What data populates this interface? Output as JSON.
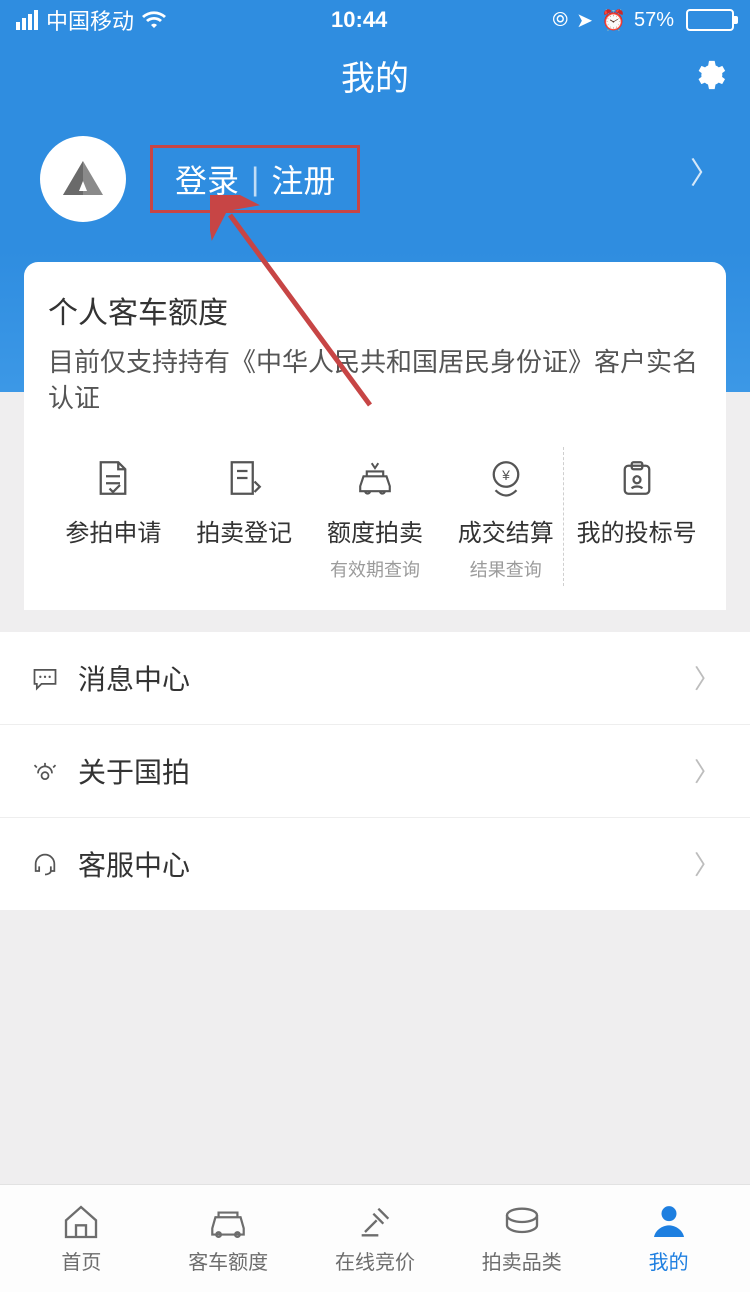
{
  "statusbar": {
    "carrier": "中国移动",
    "time": "10:44",
    "battery_pct": "57%"
  },
  "header": {
    "title": "我的",
    "login_label": "登录",
    "register_label": "注册"
  },
  "card": {
    "title": "个人客车额度",
    "desc": "目前仅支持持有《中华人民共和国居民身份证》客户实名认证",
    "actions": [
      {
        "label": "参拍申请",
        "sub": ""
      },
      {
        "label": "拍卖登记",
        "sub": ""
      },
      {
        "label": "额度拍卖",
        "sub": "有效期查询"
      },
      {
        "label": "成交结算",
        "sub": "结果查询"
      },
      {
        "label": "我的投标号",
        "sub": ""
      }
    ]
  },
  "list": [
    {
      "label": "消息中心"
    },
    {
      "label": "关于国拍"
    },
    {
      "label": "客服中心"
    }
  ],
  "tabs": [
    {
      "label": "首页"
    },
    {
      "label": "客车额度"
    },
    {
      "label": "在线竞价"
    },
    {
      "label": "拍卖品类"
    },
    {
      "label": "我的"
    }
  ]
}
